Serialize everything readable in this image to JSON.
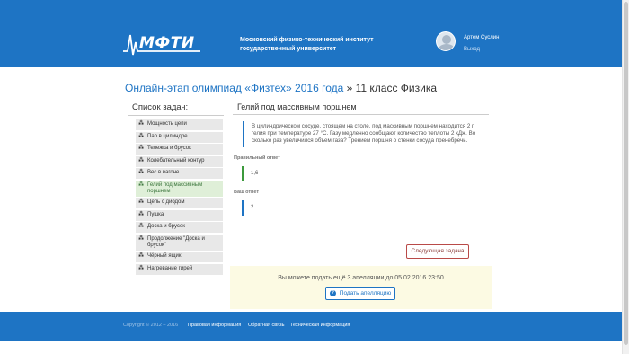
{
  "header": {
    "logo_text": "МФТИ",
    "institution": "Московский физико-технический институт государственный университет",
    "user_name": "Артем Суслин",
    "logout": "Выход"
  },
  "title": {
    "link": "Онлайн-этап олимпиад «Физтех» 2016 года",
    "suffix": " » 11 класс Физика"
  },
  "sidebar": {
    "heading": "Список задач:",
    "tasks": [
      {
        "label": "Мощность цепи",
        "active": false
      },
      {
        "label": "Пар в цилиндре",
        "active": false
      },
      {
        "label": "Тележка и брусок",
        "active": false
      },
      {
        "label": "Колебательный контур",
        "active": false
      },
      {
        "label": "Вес в вагоне",
        "active": false
      },
      {
        "label": "Гелий под массивным поршнем",
        "active": true
      },
      {
        "label": "Цепь с диодом",
        "active": false
      },
      {
        "label": "Пушка",
        "active": false
      },
      {
        "label": "Доска и брусок",
        "active": false
      },
      {
        "label": "Продолжение \"Доска и брусок\"",
        "active": false
      },
      {
        "label": "Чёрный ящик",
        "active": false
      },
      {
        "label": "Нагревание гирей",
        "active": false
      }
    ]
  },
  "main": {
    "title": "Гелий под массивным поршнем",
    "problem": "В цилиндрическом сосуде, стоящем на столе, под массивным поршнем находится 2 г гелия при температуре 27 °C. Газу медленно сообщают количество теплоты 2 кДж. Во сколько раз увеличился объем газа? Трением поршня о стенки сосуда пренебречь.",
    "correct_label": "Правильный ответ",
    "correct_value": "1,6",
    "your_label": "Ваш ответ",
    "your_value": "2",
    "next_button": "Следующая задача"
  },
  "appeal": {
    "text": "Вы можете подать ещё 3 апелляции до 05.02.2016 23:50",
    "button": "Подать апелляцию"
  },
  "footer": {
    "copyright": "Copyright © 2012 – 2016",
    "links": [
      "Правовая информация",
      "Обратная связь",
      "Техническая информация"
    ]
  },
  "colors": {
    "brand_blue": "#1e74c4",
    "active_green": "#dfefd8",
    "appeal_bg": "#fcfae3"
  }
}
